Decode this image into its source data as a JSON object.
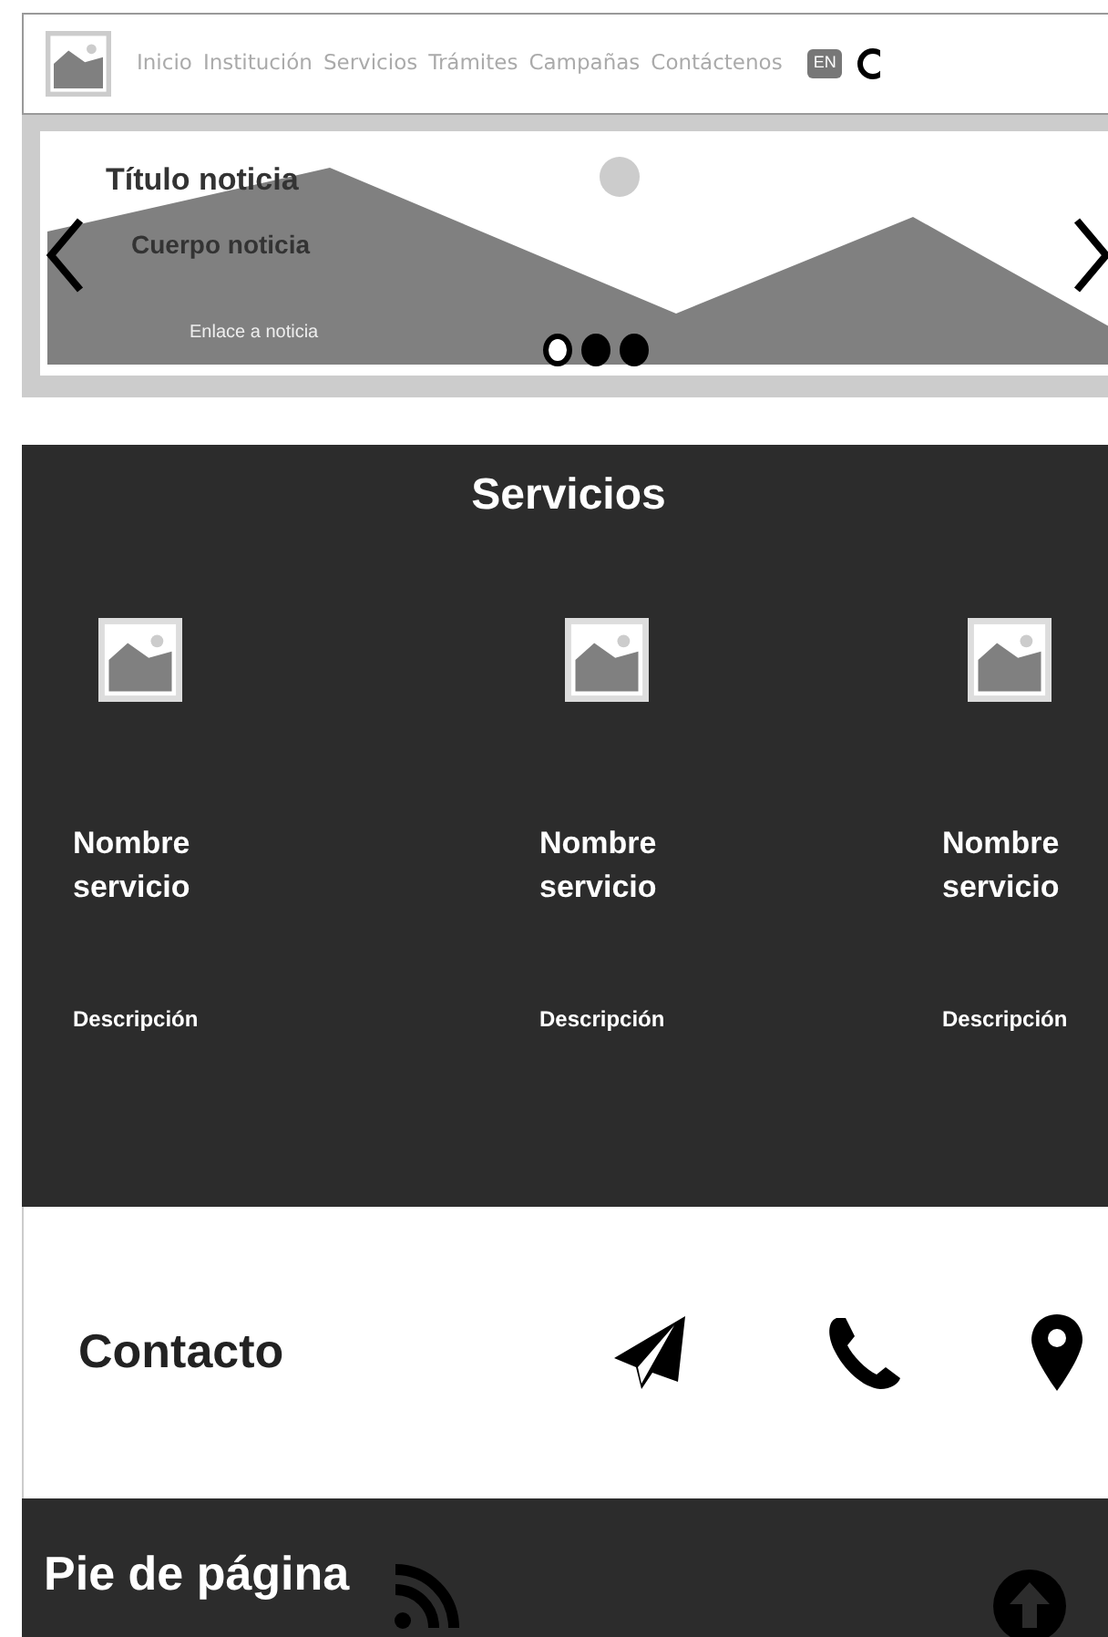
{
  "nav": {
    "links": [
      "Inicio",
      "Institución",
      "Servicios",
      "Trámites",
      "Campañas",
      "Contáctenos"
    ],
    "language": "EN"
  },
  "carousel": {
    "title": "Título noticia",
    "body": "Cuerpo noticia",
    "link": "Enlace a noticia",
    "indicators": [
      {
        "selected": true
      },
      {
        "selected": false
      },
      {
        "selected": false
      }
    ]
  },
  "services": {
    "title": "Servicios",
    "items": [
      {
        "name": "Nombre servicio",
        "description": "Descripción"
      },
      {
        "name": "Nombre servicio",
        "description": "Descripción"
      },
      {
        "name": "Nombre servicio",
        "description": "Descripción"
      }
    ]
  },
  "contact": {
    "title": "Contacto"
  },
  "footer": {
    "title": "Pie de página"
  }
}
